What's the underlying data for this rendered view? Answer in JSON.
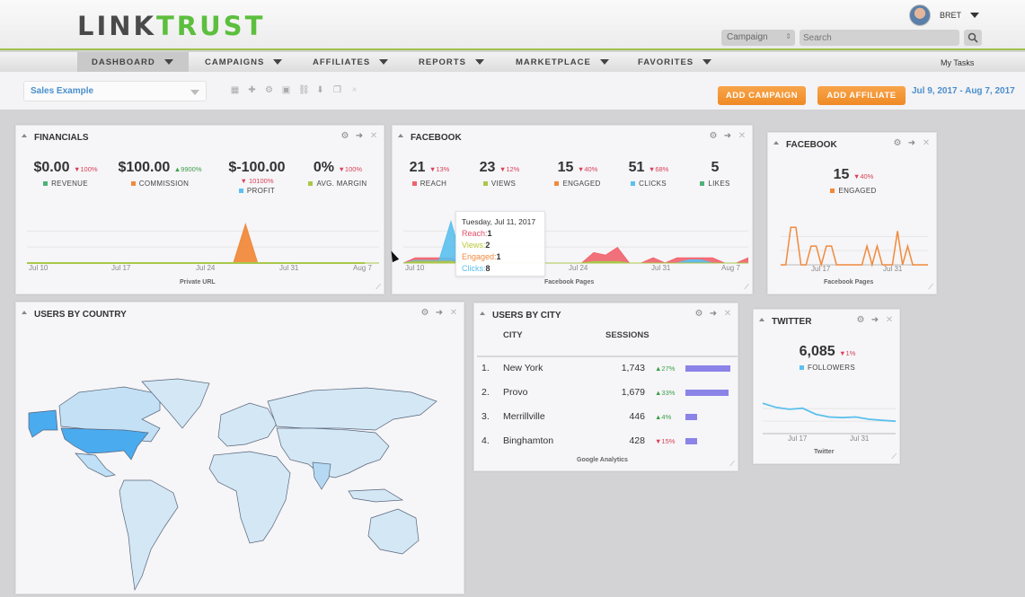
{
  "header": {
    "logo_left": "LINK",
    "logo_right": "TRUST",
    "user_name": "BRET",
    "search_scope": "Campaign",
    "search_placeholder": "Search"
  },
  "nav": {
    "items": [
      {
        "label": "DASHBOARD",
        "active": true
      },
      {
        "label": "CAMPAIGNS"
      },
      {
        "label": "AFFILIATES"
      },
      {
        "label": "REPORTS"
      },
      {
        "label": "MARKETPLACE"
      },
      {
        "label": "FAVORITES"
      }
    ],
    "my_tasks": "My Tasks"
  },
  "toolbar": {
    "dashboard_select": "Sales Example",
    "icons": [
      "grid-icon",
      "plus-icon",
      "gear-icon",
      "image-icon",
      "link-icon",
      "download-icon",
      "copy-icon",
      "close-icon"
    ],
    "add_campaign": "ADD CAMPAIGN",
    "add_affiliate": "ADD AFFILIATE",
    "date_range": "Jul 9, 2017 - Aug 7, 2017"
  },
  "colors": {
    "accent_orange": "#f39331",
    "link_blue": "#4a8fcd",
    "brand_green": "#5cbf3e",
    "reach": "#f1636d",
    "views": "#a9c84a",
    "engaged": "#f08a3c",
    "clicks": "#5bc0ee",
    "likes": "#4db37a",
    "bar": "#8c83e8"
  },
  "financials": {
    "title": "FINANCIALS",
    "metrics": [
      {
        "value": "$0.00",
        "change": "▼100%",
        "dir": "down",
        "label": "REVENUE",
        "color": "#4db37a"
      },
      {
        "value": "$100.00",
        "change": "▲9900%",
        "dir": "up",
        "label": "COMMISSION",
        "color": "#f08a3c"
      },
      {
        "value": "$-100.00",
        "change": "▼ 10100%",
        "dir": "down",
        "label": "PROFIT",
        "color": "#5bc0ee"
      },
      {
        "value": "0%",
        "change": "▼100%",
        "dir": "down",
        "label": "AVG. MARGIN",
        "color": "#a9c84a"
      }
    ],
    "source": "Private URL",
    "x_ticks": [
      "Jul 10",
      "Jul 17",
      "Jul 24",
      "Jul 31",
      "Aug 7"
    ]
  },
  "facebook_main": {
    "title": "FACEBOOK",
    "metrics": [
      {
        "value": "21",
        "change": "▼13%",
        "dir": "down",
        "label": "REACH",
        "color": "#f1636d"
      },
      {
        "value": "23",
        "change": "▼12%",
        "dir": "down",
        "label": "VIEWS",
        "color": "#a9c84a"
      },
      {
        "value": "15",
        "change": "▼40%",
        "dir": "down",
        "label": "ENGAGED",
        "color": "#f08a3c"
      },
      {
        "value": "51",
        "change": "▼68%",
        "dir": "down",
        "label": "CLICKS",
        "color": "#5bc0ee"
      },
      {
        "value": "5",
        "change": "",
        "dir": "",
        "label": "LIKES",
        "color": "#4db37a"
      }
    ],
    "source": "Facebook Pages",
    "x_ticks": [
      "Jul 10",
      "Jul 24",
      "Jul 31",
      "Aug 7"
    ],
    "tooltip": {
      "date": "Tuesday, Jul 11, 2017",
      "rows": [
        {
          "label": "Reach:",
          "value": "1",
          "color": "#e0506a"
        },
        {
          "label": "Views:",
          "value": "2",
          "color": "#b9c83a"
        },
        {
          "label": "Engaged:",
          "value": "1",
          "color": "#f08a3c"
        },
        {
          "label": "Clicks:",
          "value": "8",
          "color": "#5bc0ee"
        }
      ]
    }
  },
  "facebook_small": {
    "title": "FACEBOOK",
    "metric": {
      "value": "15",
      "change": "▼40%",
      "label": "ENGAGED",
      "color": "#f08a3c"
    },
    "source": "Facebook Pages",
    "x_ticks": [
      "Jul 17",
      "Jul 31"
    ]
  },
  "users_by_country": {
    "title": "USERS BY COUNTRY",
    "highlighted": [
      "United States",
      "Alaska"
    ]
  },
  "users_by_city": {
    "title": "USERS BY CITY",
    "columns": [
      "CITY",
      "SESSIONS"
    ],
    "rows": [
      {
        "rank": "1.",
        "city": "New York",
        "sessions": "1,743",
        "change": "▲27%",
        "dir": "up",
        "share": 1.0
      },
      {
        "rank": "2.",
        "city": "Provo",
        "sessions": "1,679",
        "change": "▲33%",
        "dir": "up",
        "share": 0.96
      },
      {
        "rank": "3.",
        "city": "Merrillville",
        "sessions": "446",
        "change": "▲4%",
        "dir": "up",
        "share": 0.26
      },
      {
        "rank": "4.",
        "city": "Binghamton",
        "sessions": "428",
        "change": "▼15%",
        "dir": "down",
        "share": 0.25
      }
    ],
    "source": "Google Analytics"
  },
  "twitter": {
    "title": "TWITTER",
    "metric": {
      "value": "6,085",
      "change": "▼1%",
      "label": "FOLLOWERS",
      "color": "#5bc0ee"
    },
    "source": "Twitter",
    "x_ticks": [
      "Jul 17",
      "Jul 31"
    ]
  },
  "chart_data": [
    {
      "type": "area",
      "title": "Financials",
      "x": [
        "Jul 9",
        "Jul 10",
        "Jul 11",
        "Jul 12",
        "Jul 13",
        "Jul 14",
        "Jul 15",
        "Jul 16",
        "Jul 17",
        "Jul 18",
        "Jul 19",
        "Jul 20",
        "Jul 21",
        "Jul 22",
        "Jul 23",
        "Jul 24",
        "Jul 25",
        "Jul 26",
        "Jul 27",
        "Jul 28",
        "Jul 29",
        "Jul 30",
        "Jul 31",
        "Aug 1",
        "Aug 2",
        "Aug 3",
        "Aug 4",
        "Aug 5",
        "Aug 6",
        "Aug 7"
      ],
      "series": [
        {
          "name": "Commission",
          "values": [
            0,
            0,
            0,
            0,
            0,
            0,
            0,
            0,
            0,
            0,
            0,
            0,
            0,
            0,
            0,
            0,
            0,
            0,
            100,
            0,
            0,
            0,
            0,
            0,
            0,
            0,
            0,
            0,
            0,
            0
          ]
        },
        {
          "name": "Revenue",
          "values": [
            0,
            0,
            0,
            0,
            0,
            0,
            0,
            0,
            0,
            0,
            0,
            0,
            0,
            0,
            0,
            0,
            0,
            0,
            0,
            0,
            0,
            0,
            0,
            0,
            0,
            0,
            0,
            0,
            0,
            0
          ]
        }
      ],
      "x_ticks": [
        "Jul 10",
        "Jul 17",
        "Jul 24",
        "Jul 31",
        "Aug 7"
      ],
      "xlabel": "Private URL"
    },
    {
      "type": "area",
      "title": "Facebook",
      "x": [
        "Jul 9",
        "Jul 10",
        "Jul 11",
        "Jul 12",
        "Jul 13",
        "Jul 14",
        "Jul 15",
        "Jul 16",
        "Jul 17",
        "Jul 18",
        "Jul 19",
        "Jul 20",
        "Jul 21",
        "Jul 22",
        "Jul 23",
        "Jul 24",
        "Jul 25",
        "Jul 26",
        "Jul 27",
        "Jul 28",
        "Jul 29",
        "Jul 30",
        "Jul 31",
        "Aug 1",
        "Aug 2",
        "Aug 3",
        "Aug 4",
        "Aug 5",
        "Aug 6",
        "Aug 7"
      ],
      "series": [
        {
          "name": "Reach",
          "values": [
            0,
            1,
            1,
            1,
            1,
            0,
            0,
            0,
            0,
            0,
            0,
            0,
            0,
            0,
            0,
            0,
            2,
            1.5,
            3,
            0,
            0,
            1,
            0,
            1,
            1,
            1,
            1,
            0,
            0,
            1
          ]
        },
        {
          "name": "Views",
          "values": [
            0,
            0.3,
            0.3,
            0.3,
            0.3,
            0,
            0,
            0,
            0,
            0,
            0,
            0,
            0,
            0,
            0,
            0,
            0.3,
            0.3,
            0.3,
            0,
            0,
            0,
            0,
            0,
            0,
            0,
            0,
            0,
            0,
            0
          ]
        },
        {
          "name": "Engaged",
          "values": [
            0,
            0.3,
            0.3,
            0.3,
            0.3,
            0,
            0,
            0,
            0,
            0,
            0,
            0,
            0,
            0,
            0,
            0,
            0.2,
            0.2,
            0.2,
            0,
            0,
            0,
            0,
            0,
            0,
            0,
            0,
            0,
            0,
            0
          ]
        },
        {
          "name": "Clicks",
          "values": [
            0,
            0.5,
            0.5,
            0.5,
            8,
            0,
            0,
            0,
            0,
            0,
            0,
            0,
            0,
            0,
            0,
            0,
            0,
            0,
            0,
            0,
            0,
            0,
            0,
            0,
            0.6,
            0.6,
            0,
            0,
            0,
            0
          ]
        }
      ],
      "x_ticks": [
        "Jul 10",
        "Jul 24",
        "Jul 31",
        "Aug 7"
      ],
      "xlabel": "Facebook Pages"
    },
    {
      "type": "line",
      "title": "Facebook Engaged",
      "x": [
        "Jul 9",
        "Jul 10",
        "Jul 11",
        "Jul 12",
        "Jul 13",
        "Jul 14",
        "Jul 15",
        "Jul 16",
        "Jul 17",
        "Jul 18",
        "Jul 19",
        "Jul 20",
        "Jul 21",
        "Jul 22",
        "Jul 23",
        "Jul 24",
        "Jul 25",
        "Jul 26",
        "Jul 27",
        "Jul 28",
        "Jul 29",
        "Jul 30",
        "Jul 31",
        "Aug 1",
        "Aug 2",
        "Aug 3",
        "Aug 4",
        "Aug 5",
        "Aug 6",
        "Aug 7"
      ],
      "series": [
        {
          "name": "Engaged",
          "values": [
            0,
            0,
            3,
            3,
            0,
            0,
            1.5,
            1.5,
            0,
            1.5,
            1.5,
            0,
            0,
            0,
            0,
            0,
            0,
            1.5,
            0,
            1.5,
            0,
            0,
            0,
            2.7,
            0,
            1.5,
            0,
            0,
            0,
            0
          ]
        }
      ],
      "x_ticks": [
        "Jul 17",
        "Jul 31"
      ],
      "xlabel": "Facebook Pages"
    },
    {
      "type": "line",
      "title": "Twitter Followers",
      "x": [
        "Jul 9",
        "Jul 12",
        "Jul 15",
        "Jul 18",
        "Jul 21",
        "Jul 24",
        "Jul 27",
        "Jul 30",
        "Aug 2",
        "Aug 5",
        "Aug 7"
      ],
      "series": [
        {
          "name": "Followers",
          "values": [
            6150,
            6135,
            6128,
            6132,
            6110,
            6100,
            6098,
            6100,
            6092,
            6088,
            6085
          ]
        }
      ],
      "x_ticks": [
        "Jul 17",
        "Jul 31"
      ],
      "xlabel": "Twitter"
    }
  ]
}
